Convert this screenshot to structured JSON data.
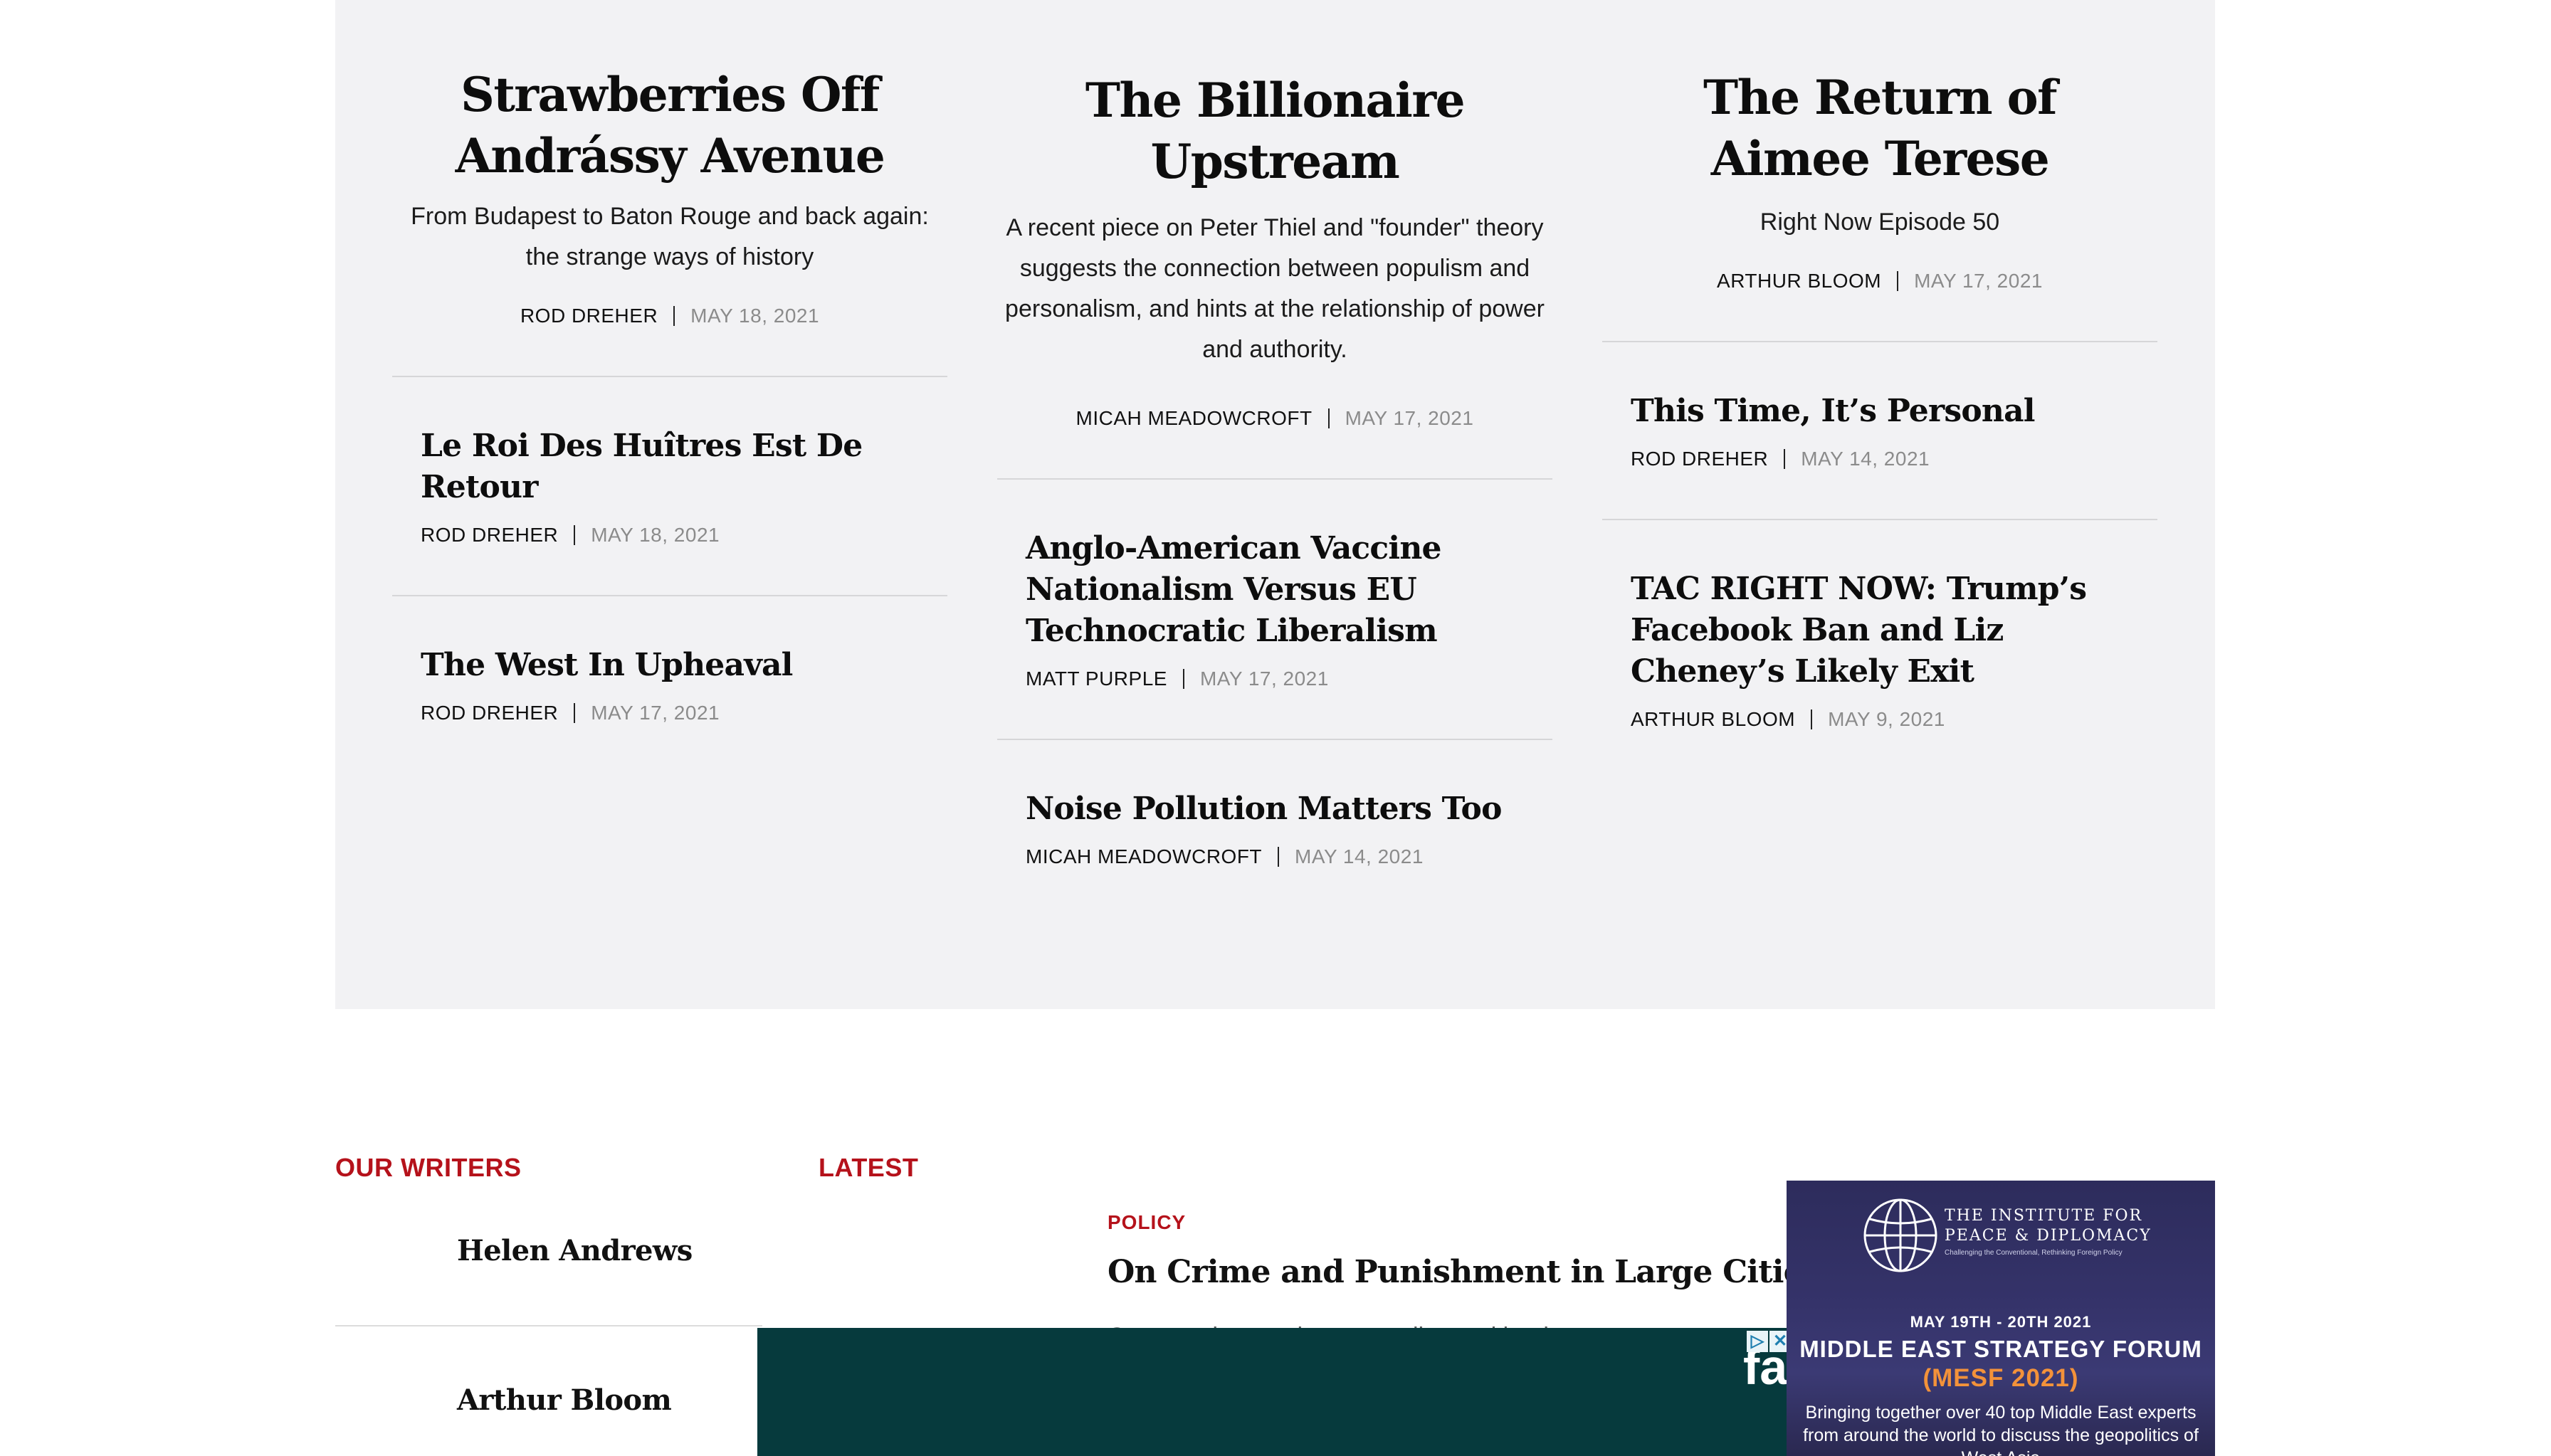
{
  "featured": {
    "columns": [
      {
        "lead": {
          "title": "Strawberries Off Andrássy Avenue",
          "dek": "From Budapest to Baton Rouge and back again: the strange ways of history",
          "author": "ROD DREHER",
          "date": "MAY 18, 2021"
        },
        "items": [
          {
            "title": "Le Roi Des Huîtres Est De Retour",
            "author": "ROD DREHER",
            "date": "MAY 18, 2021"
          },
          {
            "title": "The West In Upheaval",
            "author": "ROD DREHER",
            "date": "MAY 17, 2021"
          }
        ]
      },
      {
        "lead": {
          "title": "The Billionaire Upstream",
          "dek": "A recent piece on Peter Thiel and \"founder\" theory suggests the connection between populism and personalism, and hints at the relationship of power and authority.",
          "author": "MICAH MEADOWCROFT",
          "date": "MAY 17, 2021"
        },
        "items": [
          {
            "title": "Anglo-American Vaccine Nationalism Versus EU Technocratic Liberalism",
            "author": "MATT PURPLE",
            "date": "MAY 17, 2021"
          },
          {
            "title": "Noise Pollution Matters Too",
            "author": "MICAH MEADOWCROFT",
            "date": "MAY 14, 2021"
          }
        ]
      },
      {
        "lead": {
          "title": "The Return of Aimee Terese",
          "dek": "Right Now Episode 50",
          "author": "ARTHUR BLOOM",
          "date": "MAY 17, 2021"
        },
        "items": [
          {
            "title": "This Time, It’s Personal",
            "author": "ROD DREHER",
            "date": "MAY 14, 2021"
          },
          {
            "title": "TAC RIGHT NOW: Trump’s Facebook Ban and Liz Cheney’s Likely Exit",
            "author": "ARTHUR BLOOM",
            "date": "MAY 9, 2021"
          }
        ]
      }
    ]
  },
  "writers": {
    "label": "OUR WRITERS",
    "names": [
      "Helen Andrews",
      "Arthur Bloom"
    ]
  },
  "latest": {
    "label": "LATEST",
    "kicker": "POLICY",
    "title": "On Crime and Punishment in Large Cities",
    "dek_partial": "Consent decrees hamper police and lead to"
  },
  "ads": {
    "bar_logo": "fas",
    "box": {
      "institute": "THE INSTITUTE FOR PEACE & DIPLOMACY",
      "tagline": "Challenging the Conventional, Rethinking Foreign Policy",
      "dates": "MAY 19TH - 20TH 2021",
      "forum": "MIDDLE EAST STRATEGY FORUM",
      "acronym": "(MESF 2021)",
      "blurb": "Bringing together over 40 top Middle East experts from around the world to discuss the geopolitics of West Asia"
    }
  },
  "colors": {
    "accent": "#b5121b",
    "panel": "#f2f2f4",
    "ad_bar": "#063a3d"
  }
}
